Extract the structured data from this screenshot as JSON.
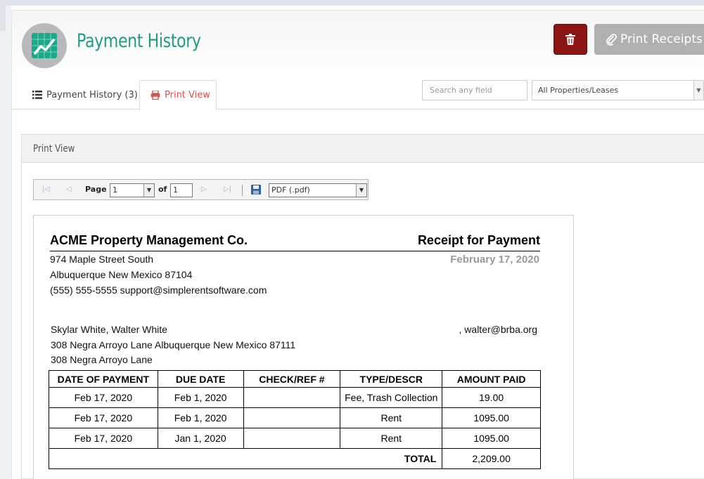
{
  "header": {
    "title": "Payment History",
    "print_receipts_label": "Print Receipts"
  },
  "tabs": [
    {
      "label": "Payment History (3)"
    },
    {
      "label": "Print View"
    }
  ],
  "filters": {
    "search_placeholder": "Search any field",
    "property_select": "All Properties/Leases"
  },
  "section": {
    "title": "Print View"
  },
  "viewer": {
    "page_label": "Page",
    "page_value": "1",
    "of_label": "of",
    "page_total": "1",
    "format": "PDF (.pdf)"
  },
  "receipt": {
    "company": "ACME Property Management Co.",
    "title": "Receipt for Payment",
    "company_address": [
      "974 Maple Street South",
      "Albuquerque New Mexico 87104",
      "(555) 555-5555 support@simplerentsoftware.com"
    ],
    "date": "February 17, 2020",
    "tenant_names": "Skylar White, Walter White",
    "tenant_email": ", walter@brba.org",
    "tenant_address": "308 Negra Arroyo Lane Albuquerque New Mexico 87111",
    "property": "308 Negra Arroyo Lane",
    "columns": [
      "DATE OF PAYMENT",
      "DUE DATE",
      "CHECK/REF #",
      "TYPE/DESCR",
      "AMOUNT PAID"
    ],
    "rows": [
      [
        "Feb 17, 2020",
        "Feb 1, 2020",
        "",
        "Fee, Trash Collection",
        "19.00"
      ],
      [
        "Feb 17, 2020",
        "Feb 1, 2020",
        "",
        "Rent",
        "1095.00"
      ],
      [
        "Feb 17, 2020",
        "Jan 1, 2020",
        "",
        "Rent",
        "1095.00"
      ]
    ],
    "total_label": "TOTAL",
    "total_value": "2,209.00"
  },
  "colors": {
    "accent": "#1f9d85",
    "danger": "#8b1414",
    "tab_active": "#d9534f",
    "button_disabled": "#b0b0b0"
  }
}
